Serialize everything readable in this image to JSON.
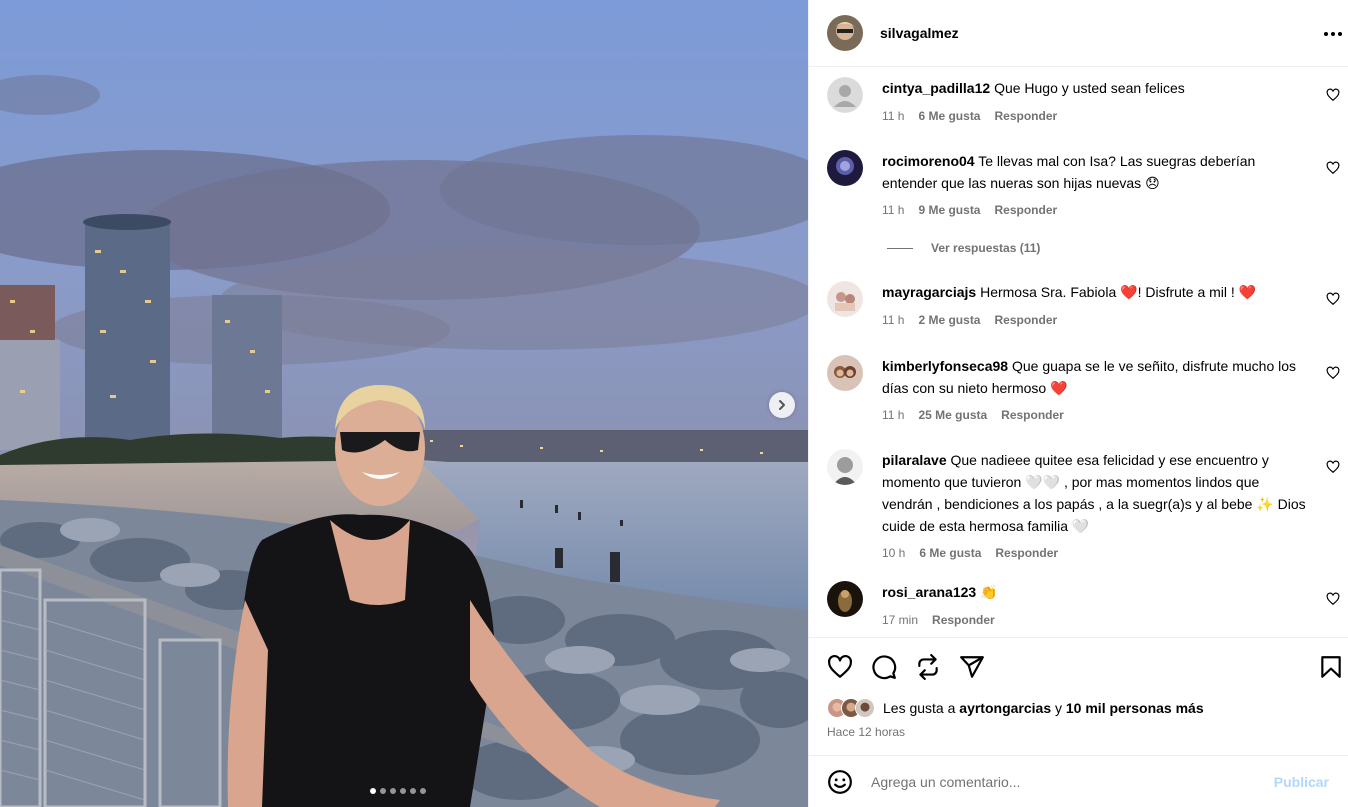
{
  "post": {
    "username": "silvagalmez",
    "image_count": 6,
    "active_image": 1
  },
  "comments": [
    {
      "username": "cintya_padilla12",
      "text": "Que Hugo y usted sean felices",
      "time": "11 h",
      "likes": "6 Me gusta",
      "reply": "Responder"
    },
    {
      "username": "rocimoreno04",
      "text": "Te llevas mal con Isa? Las suegras deberían entender que las nueras son hijas nuevas 😞",
      "time": "11 h",
      "likes": "9 Me gusta",
      "reply": "Responder",
      "view_replies": "Ver respuestas (11)"
    },
    {
      "username": "mayragarciajs",
      "text": "Hermosa Sra. Fabiola ❤️! Disfrute a mil ! ❤️",
      "time": "11 h",
      "likes": "2 Me gusta",
      "reply": "Responder"
    },
    {
      "username": "kimberlyfonseca98",
      "text": "Que guapa se le ve señito, disfrute mucho los días con su nieto hermoso ❤️",
      "time": "11 h",
      "likes": "25 Me gusta",
      "reply": "Responder"
    },
    {
      "username": "pilaralave",
      "text": "Que nadieee quitee esa felicidad y ese encuentro y momento que tuvieron 🤍🤍 , por mas momentos lindos que vendrán , bendiciones a los papás , a la suegr(a)s y al bebe ✨ Dios cuide de esta hermosa familia 🤍",
      "time": "10 h",
      "likes": "6 Me gusta",
      "reply": "Responder"
    },
    {
      "username": "rosi_arana123",
      "text": "👏",
      "time": "17 min",
      "reply": "Responder"
    }
  ],
  "likes": {
    "prefix": "Les gusta a",
    "user": "ayrtongarcias",
    "connector": "y",
    "others": "10 mil personas más"
  },
  "time_ago": "Hace 12 horas",
  "add_comment": {
    "placeholder": "Agrega un comentario...",
    "publish_label": "Publicar"
  },
  "icons": {
    "more": "more-horizontal-icon",
    "like": "heart-outline-icon",
    "comment": "comment-bubble-icon",
    "share": "repost-icon",
    "send": "paper-plane-icon",
    "save": "bookmark-icon",
    "emoji": "emoji-smile-icon",
    "next": "chevron-right-icon"
  },
  "colors": {
    "link": "#0095f6",
    "publish_disabled": "#b3d7fb",
    "secondary_text": "#737373"
  }
}
